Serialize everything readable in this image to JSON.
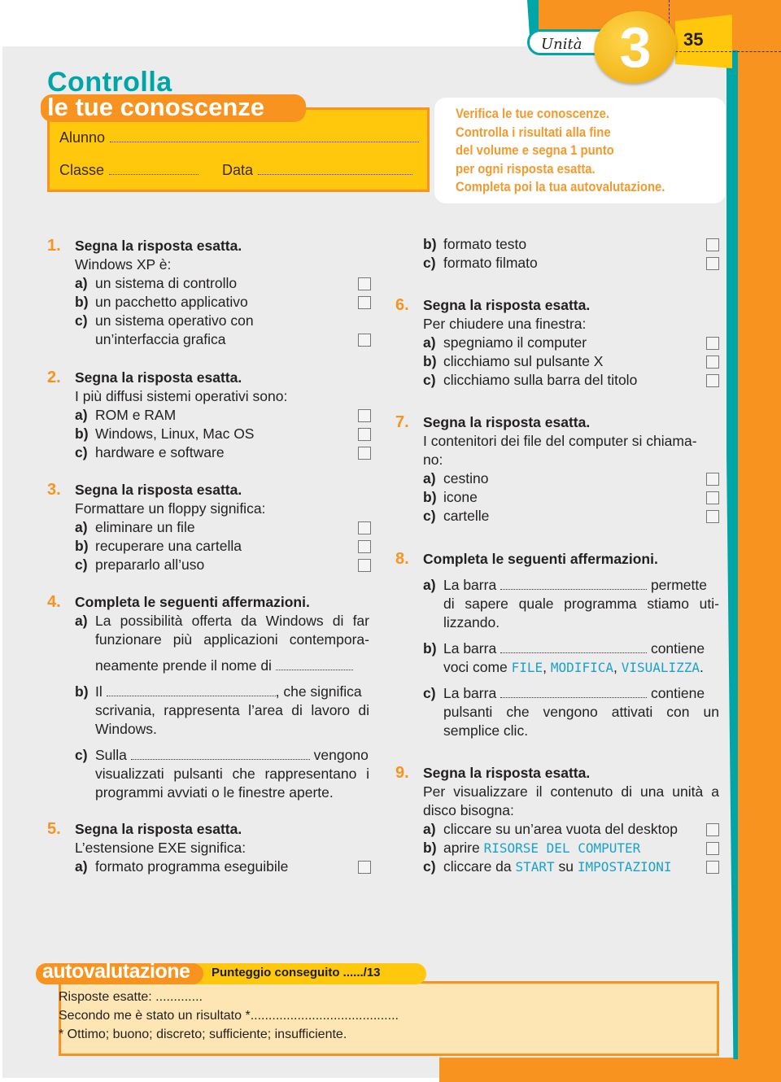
{
  "header": {
    "unit_label": "Unità",
    "unit_number": "3",
    "page_number": "35"
  },
  "title": {
    "line1": "Controlla",
    "line2": "le tue conoscenze"
  },
  "student_info": {
    "alunno_label": "Alunno",
    "classe_label": "Classe",
    "data_label": "Data"
  },
  "intro": {
    "lines": [
      "Verifica le tue conoscenze.",
      "Controlla i risultati alla fine",
      "del volume e segna 1 punto",
      "per ogni risposta esatta.",
      "Completa poi la tua autovalutazione."
    ]
  },
  "questions": [
    {
      "num": "1.",
      "title": "Segna la risposta esatta.",
      "prompt": "Windows XP è:",
      "options": [
        {
          "label": "a)",
          "text": "un sistema di controllo"
        },
        {
          "label": "b)",
          "text": "un pacchetto applicativo"
        },
        {
          "label": "c)",
          "text": "un sistema operativo con",
          "text2": "un’interfaccia grafica"
        }
      ]
    },
    {
      "num": "2.",
      "title": "Segna la risposta esatta.",
      "prompt": "I più diffusi sistemi operativi sono:",
      "options": [
        {
          "label": "a)",
          "text": "ROM e RAM"
        },
        {
          "label": "b)",
          "text": "Windows, Linux, Mac OS"
        },
        {
          "label": "c)",
          "text": "hardware e software"
        }
      ]
    },
    {
      "num": "3.",
      "title": "Segna la risposta esatta.",
      "prompt": "Formattare un floppy significa:",
      "options": [
        {
          "label": "a)",
          "text": "eliminare un file"
        },
        {
          "label": "b)",
          "text": "recuperare una cartella"
        },
        {
          "label": "c)",
          "text": "prepararlo all’uso"
        }
      ]
    },
    {
      "num": "4.",
      "title": "Completa le seguenti affermazioni.",
      "items": [
        {
          "label": "a)",
          "line1": "La possibilità offerta da Windows di far",
          "line2": "funzionare più applicazioni contempora-",
          "line3": "neamente prende il nome di"
        },
        {
          "label": "b)",
          "pre": "Il",
          "post": ", che significa",
          "line2": "scrivania, rappresenta l’area di lavoro di",
          "line3": "Windows."
        },
        {
          "label": "c)",
          "pre": "Sulla",
          "post": "vengono",
          "line2": "visualizzati pulsanti che rappresentano i",
          "line3": "programmi avviati o le finestre aperte."
        }
      ]
    },
    {
      "num": "5.",
      "title": "Segna la risposta esatta.",
      "prompt": "L’estensione EXE significa:",
      "options": [
        {
          "label": "a)",
          "text": "formato programma eseguibile"
        },
        {
          "label": "b)",
          "text": "formato testo"
        },
        {
          "label": "c)",
          "text": "formato filmato"
        }
      ]
    },
    {
      "num": "6.",
      "title": "Segna la risposta esatta.",
      "prompt": "Per chiudere una finestra:",
      "options": [
        {
          "label": "a)",
          "text": "spegniamo il computer"
        },
        {
          "label": "b)",
          "text": "clicchiamo sul pulsante X"
        },
        {
          "label": "c)",
          "text": "clicchiamo sulla barra del titolo"
        }
      ]
    },
    {
      "num": "7.",
      "title": "Segna la risposta esatta.",
      "prompt": "I contenitori dei file del computer si chiama-",
      "prompt2": "no:",
      "options": [
        {
          "label": "a)",
          "text": "cestino"
        },
        {
          "label": "b)",
          "text": "icone"
        },
        {
          "label": "c)",
          "text": "cartelle"
        }
      ]
    },
    {
      "num": "8.",
      "title": "Completa le seguenti affermazioni.",
      "items": [
        {
          "label": "a)",
          "pre": "La barra",
          "post": "permette",
          "line2": "di sapere quale programma stiamo uti-",
          "line3": "lizzando."
        },
        {
          "label": "b)",
          "pre": "La barra",
          "post": "contiene",
          "line2_pre": "voci come ",
          "kw1": "FILE",
          "sep1": ", ",
          "kw2": "MODIFICA",
          "sep2": ", ",
          "kw3": "VISUALIZZA",
          "end": "."
        },
        {
          "label": "c)",
          "pre": "La barra",
          "post": "contiene",
          "line2": "pulsanti che vengono attivati con un",
          "line3": "semplice clic."
        }
      ]
    },
    {
      "num": "9.",
      "title": "Segna la risposta esatta.",
      "prompt": "Per visualizzare il contenuto di una unità a",
      "prompt2": "disco bisogna:",
      "options": [
        {
          "label": "a)",
          "text": "cliccare su un’area vuota del desktop"
        },
        {
          "label": "b)",
          "pre": "aprire ",
          "kw": "RISORSE DEL COMPUTER"
        },
        {
          "label": "c)",
          "pre": "cliccare da ",
          "kw": "START",
          "mid": " su ",
          "kw2": "IMPOSTAZIONI"
        }
      ]
    }
  ],
  "autovalutazione": {
    "title": "autovalutazione",
    "score": "Punteggio conseguito ....../13",
    "line1": "Risposte esatte: .............",
    "line2": "Secondo me è stato un risultato *.........................................",
    "line3": "* Ottimo; buono; discreto; sufficiente; insufficiente."
  },
  "colors": {
    "accent_orange": "#f7931e",
    "accent_teal": "#00a5a8",
    "accent_yellow": "#ffc80c",
    "keyword_blue": "#1ba2c9"
  }
}
